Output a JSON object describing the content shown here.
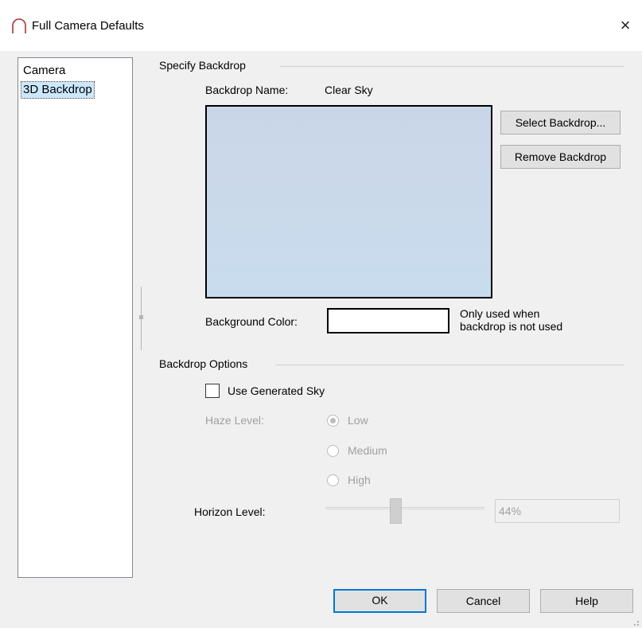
{
  "window": {
    "title": "Full Camera Defaults",
    "close_glyph": "×",
    "icon": "arch-icon"
  },
  "nav": {
    "items": [
      {
        "label": "Camera",
        "selected": false
      },
      {
        "label": "3D Backdrop",
        "selected": true
      }
    ]
  },
  "specify_backdrop": {
    "group_label": "Specify Backdrop",
    "name_label": "Backdrop Name:",
    "name_value": "Clear Sky",
    "select_button": "Select Backdrop...",
    "remove_button": "Remove Backdrop",
    "background_color_label": "Background Color:",
    "background_color_value": "#ffffff",
    "note_line1": "Only used when",
    "note_line2": "backdrop is not used"
  },
  "backdrop_options": {
    "group_label": "Backdrop Options",
    "use_generated_sky_label": "Use Generated Sky",
    "use_generated_sky_checked": false,
    "haze_label": "Haze Level:",
    "haze_options": [
      "Low",
      "Medium",
      "High"
    ],
    "haze_selected": "Low",
    "horizon_label": "Horizon Level:",
    "horizon_value_text": "44%",
    "horizon_value": 0.44
  },
  "footer": {
    "ok": "OK",
    "cancel": "Cancel",
    "help": "Help"
  }
}
